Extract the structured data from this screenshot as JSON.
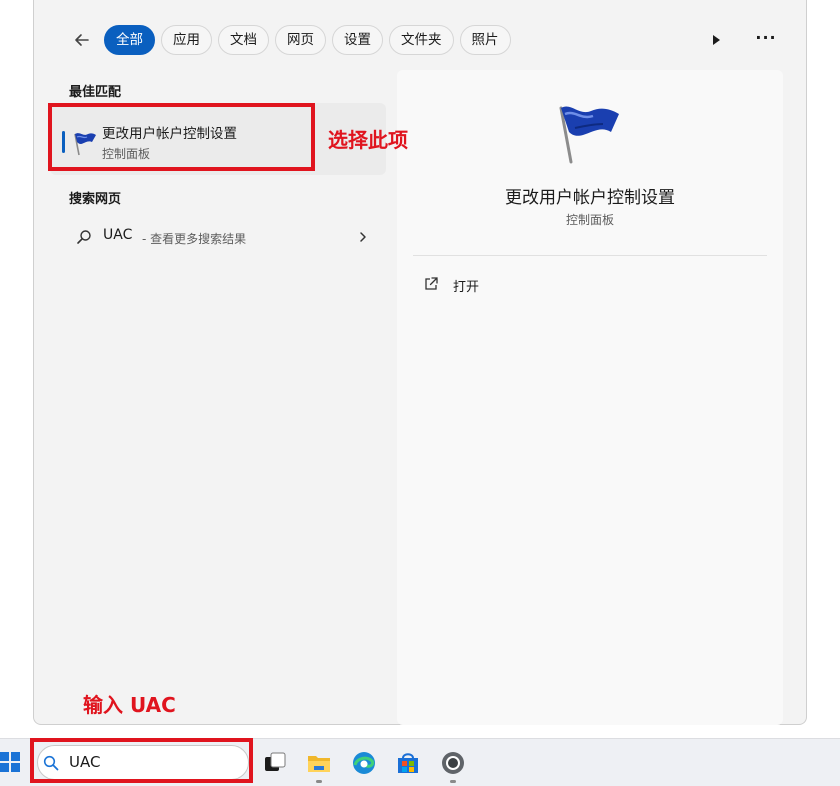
{
  "search_panel": {
    "tabs": [
      "全部",
      "应用",
      "文档",
      "网页",
      "设置",
      "文件夹",
      "照片"
    ],
    "active_tab": "全部",
    "more_label": "···",
    "best_match": {
      "heading": "最佳匹配",
      "title": "更改用户帐户控制设置",
      "subtitle": "控制面板",
      "icon": "uac-flag-icon"
    },
    "web_search": {
      "heading": "搜索网页",
      "query": "UAC",
      "hint": " - 查看更多搜索结果"
    },
    "detail": {
      "title": "更改用户帐户控制设置",
      "subtitle": "控制面板",
      "open_label": "打开"
    }
  },
  "annotations": {
    "select_label": "选择此项",
    "input_label": "输入 UAC",
    "color": "#e0141e"
  },
  "taskbar": {
    "search_value": "UAC",
    "apps": [
      "task-view-icon",
      "file-explorer-icon",
      "edge-icon",
      "store-icon",
      "chrome-icon"
    ]
  },
  "colors": {
    "accent": "#0a5fbf",
    "flag_blue": "#1a3fb0"
  }
}
